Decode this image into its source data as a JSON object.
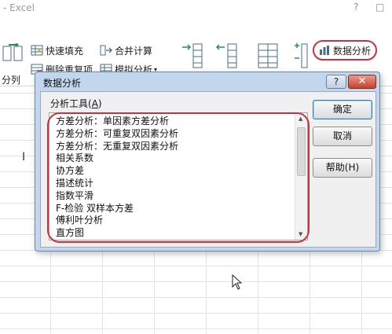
{
  "window": {
    "app_title": "- Excel",
    "help_glyph": "?",
    "restore_glyph": "□"
  },
  "ribbon": {
    "split_label": "分列",
    "flash_fill": "快速填充",
    "consolidate": "合并计算",
    "remove_duplicates": "删除重复项",
    "what_if": "模拟分析",
    "data_analysis": "数据分析",
    "accent_color": "#c9333e"
  },
  "dialog": {
    "title": "数据分析",
    "help_glyph": "?",
    "close_glyph": "✕",
    "tools_label_prefix": "分析工具(",
    "tools_label_hotkey": "A",
    "tools_label_suffix": ")",
    "items": [
      "方差分析：单因素方差分析",
      "方差分析：可重复双因素分析",
      "方差分析：无重复双因素分析",
      "相关系数",
      "协方差",
      "描述统计",
      "指数平滑",
      "F-检验 双样本方差",
      "傅利叶分析",
      "直方图"
    ],
    "buttons": {
      "ok": "确定",
      "cancel": "取消",
      "help": "帮助(H)"
    },
    "scroll_up_glyph": "▲",
    "scroll_down_glyph": "▼"
  }
}
